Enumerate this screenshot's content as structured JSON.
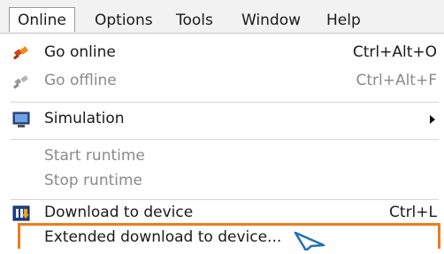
{
  "menubar": {
    "items": [
      {
        "label": "Online",
        "active": true
      },
      {
        "label": "Options"
      },
      {
        "label": "Tools"
      },
      {
        "label": "Window"
      },
      {
        "label": "Help"
      }
    ]
  },
  "dropdown": {
    "items": [
      {
        "label": "Go online",
        "shortcut": "Ctrl+Alt+O",
        "icon": "go-online-icon",
        "enabled": true
      },
      {
        "label": "Go offline",
        "shortcut": "Ctrl+Alt+F",
        "icon": "go-offline-icon",
        "enabled": false
      },
      {
        "label": "Simulation",
        "icon": "simulation-icon",
        "submenu": true,
        "enabled": true
      },
      {
        "label": "Start runtime",
        "enabled": false
      },
      {
        "label": "Stop runtime",
        "enabled": false
      },
      {
        "label": "Download to device",
        "shortcut": "Ctrl+L",
        "icon": "download-to-device-icon",
        "enabled": true
      },
      {
        "label": "Extended download to device...",
        "enabled": true,
        "highlighted": true
      }
    ]
  },
  "colors": {
    "highlight_border": "#ef7d1a",
    "cursor": "#1e6fb8"
  }
}
